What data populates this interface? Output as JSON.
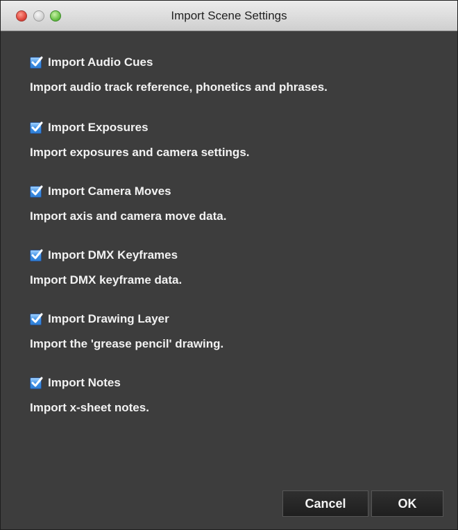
{
  "window": {
    "title": "Import Scene Settings"
  },
  "options": [
    {
      "label": "Import Audio Cues",
      "checked": true,
      "description": "Import audio track reference, phonetics and phrases."
    },
    {
      "label": "Import Exposures",
      "checked": true,
      "description": "Import exposures and camera settings."
    },
    {
      "label": "Import Camera Moves",
      "checked": true,
      "description": "Import axis and camera move data."
    },
    {
      "label": "Import DMX Keyframes",
      "checked": true,
      "description": "Import DMX keyframe data."
    },
    {
      "label": "Import Drawing Layer",
      "checked": true,
      "description": "Import the 'grease pencil' drawing."
    },
    {
      "label": "Import Notes",
      "checked": true,
      "description": "Import x-sheet notes."
    }
  ],
  "buttons": {
    "cancel_label": "Cancel",
    "ok_label": "OK"
  },
  "colors": {
    "background": "#3d3d3d",
    "text": "#f2f2f2",
    "checkbox_accent": "#3a8de4"
  }
}
